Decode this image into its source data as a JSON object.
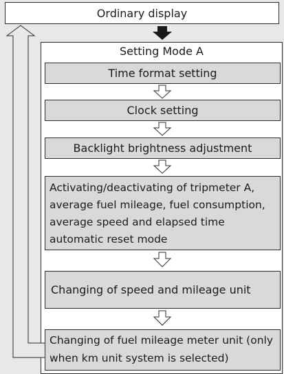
{
  "ordinary_display": "Ordinary display",
  "mode_title": "Setting Mode A",
  "steps": [
    "Time format setting",
    "Clock setting",
    "Backlight brightness adjustment",
    "Activating/deactivating of tripmeter A, average fuel mileage, fuel consumption, average speed and elapsed time automatic reset mode",
    "Changing of speed and mileage unit",
    "Changing of fuel mileage meter unit (only when km unit system is selected)"
  ],
  "colors": {
    "step_fill": "#d9d9d9",
    "panel_fill": "#ffffff",
    "line": "#2b2b2b"
  }
}
